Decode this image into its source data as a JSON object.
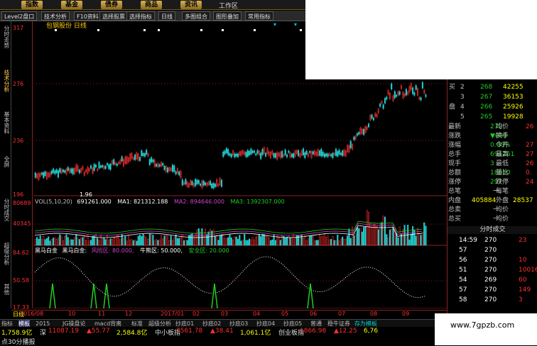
{
  "menu": {
    "tabs": [
      "指数",
      "基金",
      "债券",
      "商品",
      "资讯"
    ],
    "work_area": "工作区"
  },
  "toolbar": [
    "Level2盘口",
    "技术分析",
    "F10资料",
    "选择股票",
    "选择指标",
    "日线",
    "多图组合",
    "图形叠加",
    "常用指标"
  ],
  "sidebar": [
    "分时走势",
    "技术分析",
    "基本资料",
    "全屏",
    "分时成交",
    "超级分析",
    "其他"
  ],
  "price_axis": [
    "317",
    "276",
    "236",
    "196"
  ],
  "volume_axis": [
    "80689",
    "40345"
  ],
  "ind_axis": [
    "84.62",
    "50.58",
    "17.33"
  ],
  "stock_label": "包钢股份 日线",
  "low_label": "1.96",
  "vol_legend": {
    "a": "VOL(5,10,20)",
    "b": "691261.000",
    "c": "MA1: 821312.188",
    "d": "MA2: 894646.000",
    "e": "MA3: 1392307.000"
  },
  "ind_legend": {
    "name": "黑马白金",
    "name2": "黑马白金:",
    "risk": "风险区: 80.000,",
    "bull": "牛熊区: 50.000,",
    "safe": "安全区: 20.000"
  },
  "period": "日线",
  "dates": [
    "2016/08",
    "10",
    "11",
    "12",
    "2017/01",
    "02",
    "03",
    "04",
    "05",
    "06",
    "07",
    "08",
    "09"
  ],
  "quote": {
    "buy": [
      [
        "买",
        "2",
        "268",
        "42255"
      ],
      [
        "",
        "3",
        "267",
        "36153"
      ],
      [
        "盘",
        "4",
        "266",
        "25926"
      ],
      [
        "",
        "5",
        "265",
        "19928"
      ]
    ],
    "rows": [
      [
        "最新",
        "270",
        "均价",
        "26"
      ],
      [
        "涨跌",
        "▼000",
        "换手",
        ""
      ],
      [
        "涨幅",
        "0.00%",
        "今开",
        "27"
      ],
      [
        "总手",
        "691261",
        "最高",
        "27"
      ],
      [
        "现手",
        "3",
        "最低",
        "26"
      ],
      [
        "总额",
        "18610",
        "量比",
        "0."
      ],
      [
        "涨停",
        "297",
        "跌停",
        "24"
      ]
    ],
    "buys": [
      "总笔",
      "一",
      "每笔"
    ],
    "inout": [
      "内盘",
      "405884",
      "外盘",
      "28537"
    ],
    "totals": [
      [
        "总卖",
        "一",
        "均价"
      ],
      [
        "总买",
        "一",
        "均价"
      ]
    ],
    "trades_title": "分时成交",
    "trades": [
      [
        "14:59",
        "270",
        "23"
      ],
      [
        "57",
        "270",
        ""
      ],
      [
        "56",
        "270",
        "10"
      ],
      [
        "51",
        "270",
        "10016"
      ],
      [
        "54",
        "269",
        "60"
      ],
      [
        "57",
        "270",
        "149"
      ],
      [
        "58",
        "270",
        "3"
      ]
    ]
  },
  "bottom_tabs": [
    "指标",
    "模板",
    "2015",
    "JG操盘论",
    "macd背离",
    "标准",
    "超级分析",
    "抄底01",
    "抄底02",
    "抄底03",
    "抄底04",
    "抄底05",
    "普通",
    "稳牛证券",
    "存为模板"
  ],
  "ticker": [
    "1,758.9亿",
    "深",
    "11087.19",
    "▲55.77",
    "2,584.8亿",
    "中小板指",
    "7561.78",
    "▲38.41",
    "1,061.1亿",
    "创业板指",
    "1866.98",
    "▲12.25",
    "6,76"
  ],
  "status": "点30分播报",
  "watermark": "www.7gpzb.com",
  "colors": {
    "red": "#ff3030",
    "green": "#22cc22",
    "yellow": "#ffff00",
    "white": "#ffffff",
    "magenta": "#cc44cc",
    "cyan": "#00cccc"
  }
}
